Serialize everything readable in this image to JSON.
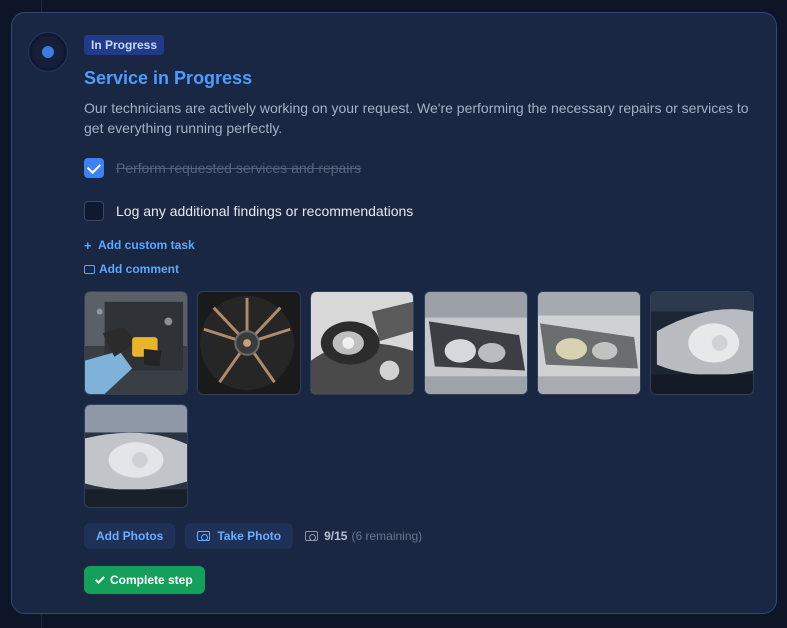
{
  "step": {
    "badge": "In Progress",
    "title": "Service in Progress",
    "description": "Our technicians are actively working on your request. We're performing the necessary repairs or services to get everything running perfectly."
  },
  "tasks": [
    {
      "label": "Perform requested services and repairs",
      "checked": true
    },
    {
      "label": "Log any additional findings or recommendations",
      "checked": false
    }
  ],
  "links": {
    "add_task": "Add custom task",
    "add_comment": "Add comment"
  },
  "photos": [
    {
      "name": "photo-1",
      "subject": "polishing-with-sponge"
    },
    {
      "name": "photo-2",
      "subject": "alloy-wheel"
    },
    {
      "name": "photo-3",
      "subject": "headlight-foam"
    },
    {
      "name": "photo-4",
      "subject": "headlight-silver-car"
    },
    {
      "name": "photo-5",
      "subject": "headlight-silver-car-2"
    },
    {
      "name": "photo-6",
      "subject": "headlight-dark-car"
    },
    {
      "name": "photo-7",
      "subject": "headlight-dark-car-2"
    }
  ],
  "actions": {
    "add_photos": "Add Photos",
    "take_photo": "Take Photo",
    "count": "9/15",
    "remaining": "(6 remaining)",
    "complete": "Complete step"
  },
  "colors": {
    "accent": "#4c9dff",
    "card": "#1a2743",
    "complete": "#14a05b"
  }
}
